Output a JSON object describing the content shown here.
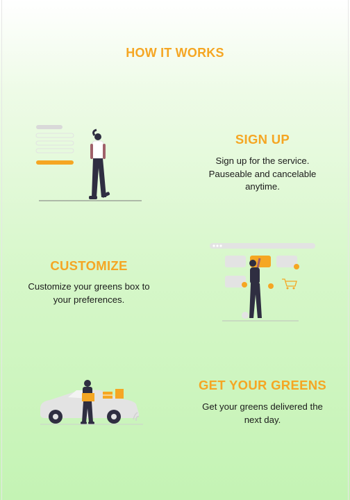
{
  "page": {
    "title": "HOW IT WORKS"
  },
  "steps": [
    {
      "title": "SIGN UP",
      "description_line1": "Sign up for the service.",
      "description_line2": "Pauseable and cancelable",
      "description_line3": "anytime.",
      "illustration": "signup-form-woman-illustration"
    },
    {
      "title": "CUSTOMIZE",
      "description_line1": "Customize your greens box to",
      "description_line2": "your preferences.",
      "illustration": "customize-dashboard-woman-illustration"
    },
    {
      "title": "GET YOUR GREENS",
      "description_line1": "Get your greens delivered the",
      "description_line2": "next day.",
      "illustration": "delivery-car-man-illustration"
    }
  ],
  "colors": {
    "accent": "#f5a623",
    "background_top": "#ffffff",
    "background_bottom": "#c4f3b4"
  }
}
